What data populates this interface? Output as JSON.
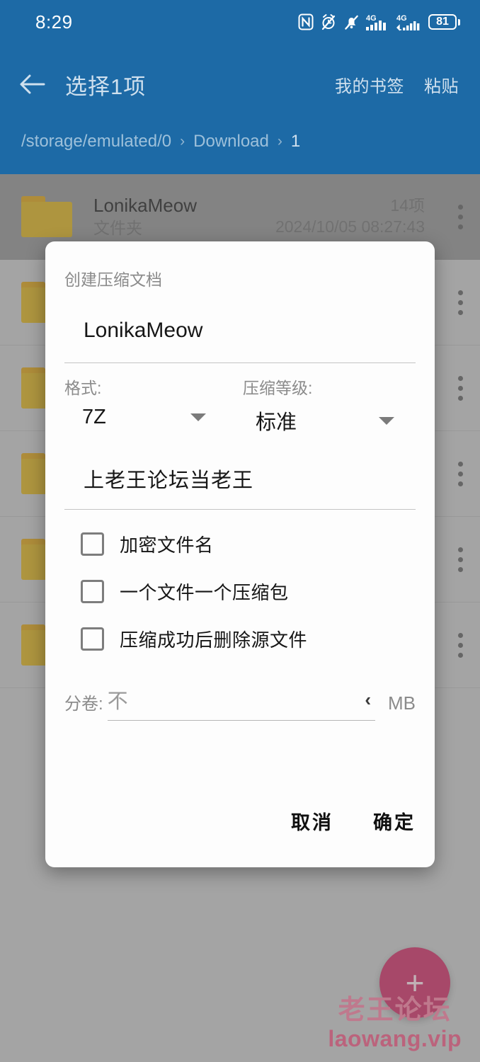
{
  "statusbar": {
    "time": "8:29",
    "icons": [
      "nfc-icon",
      "alarm-off-icon",
      "notifications-off-icon",
      "signal-4g-icon",
      "signal-4g-secondary-icon"
    ],
    "battery_level": "81",
    "signal_label": "4G"
  },
  "appbar": {
    "back_icon": "back-arrow-icon",
    "title": "选择1项",
    "actions": [
      {
        "label": "我的书签"
      },
      {
        "label": "粘贴"
      }
    ],
    "breadcrumb": [
      {
        "label": "/storage/emulated/0"
      },
      {
        "label": "Download"
      },
      {
        "label": "1"
      }
    ],
    "breadcrumb_separator": "›",
    "background_color": "#1d6aa6"
  },
  "filelist": {
    "rows": [
      {
        "name": "LonikaMeow",
        "type": "文件夹",
        "count": "14项",
        "date": "2024/10/05 08:27:43",
        "selected": true
      },
      {
        "name": "",
        "type": "",
        "count": "",
        "date": "",
        "selected": false
      },
      {
        "name": "",
        "type": "",
        "count": "",
        "date": "",
        "selected": false
      },
      {
        "name": "",
        "type": "",
        "count": "",
        "date": "",
        "selected": false
      },
      {
        "name": "",
        "type": "",
        "count": "",
        "date": "",
        "selected": false
      },
      {
        "name": "",
        "type": "",
        "count": "",
        "date": "",
        "selected": false
      }
    ]
  },
  "fab": {
    "icon": "plus-icon",
    "label": "+",
    "color": "#c6285f"
  },
  "watermark": {
    "line1": "老王论坛",
    "line2": "laowang.vip",
    "color": "#e8557f"
  },
  "dialog": {
    "title": "创建压缩文档",
    "filename": "LonikaMeow",
    "format": {
      "label": "格式:",
      "value": "7Z"
    },
    "level": {
      "label": "压缩等级:",
      "value": "标准"
    },
    "password": "上老王论坛当老王",
    "checkboxes": [
      {
        "label": "加密文件名",
        "checked": false
      },
      {
        "label": "一个文件一个压缩包",
        "checked": false
      },
      {
        "label": "压缩成功后删除源文件",
        "checked": false
      }
    ],
    "split": {
      "label": "分卷:",
      "placeholder": "不",
      "value": "",
      "unit": "MB",
      "chevron": "‹"
    },
    "buttons": {
      "cancel": "取消",
      "confirm": "确定"
    }
  }
}
